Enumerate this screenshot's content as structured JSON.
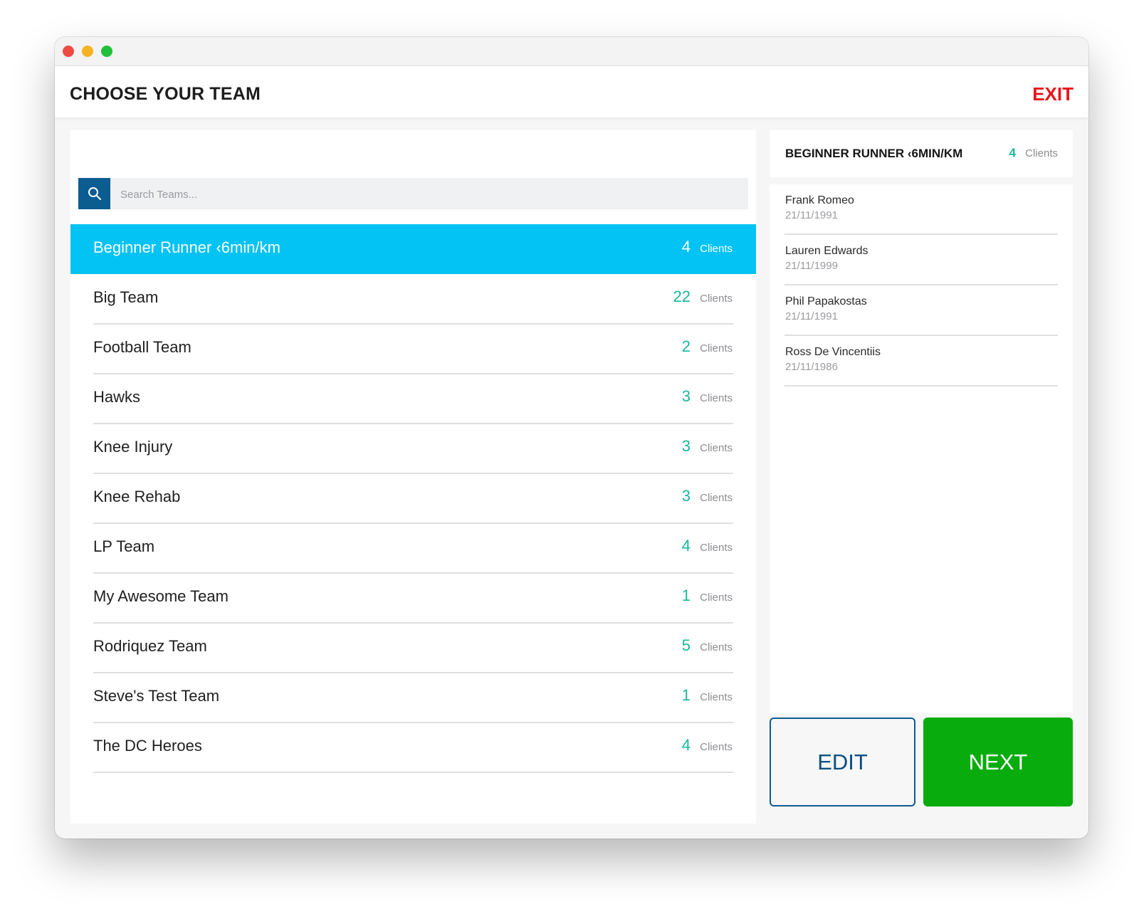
{
  "header": {
    "title": "CHOOSE YOUR TEAM",
    "exit_label": "EXIT"
  },
  "search": {
    "placeholder": "Search Teams..."
  },
  "teams": [
    {
      "name": "Beginner Runner ‹6min/km",
      "count": "4",
      "unit": "Clients",
      "selected": true
    },
    {
      "name": "Big Team",
      "count": "22",
      "unit": "Clients"
    },
    {
      "name": "Football Team",
      "count": "2",
      "unit": "Clients"
    },
    {
      "name": "Hawks",
      "count": "3",
      "unit": "Clients"
    },
    {
      "name": "Knee Injury",
      "count": "3",
      "unit": "Clients"
    },
    {
      "name": "Knee Rehab",
      "count": "3",
      "unit": "Clients"
    },
    {
      "name": "LP Team",
      "count": "4",
      "unit": "Clients"
    },
    {
      "name": "My Awesome Team",
      "count": "1",
      "unit": "Clients"
    },
    {
      "name": "Rodriquez Team",
      "count": "5",
      "unit": "Clients"
    },
    {
      "name": "Steve's Test Team",
      "count": "1",
      "unit": "Clients"
    },
    {
      "name": "The DC Heroes",
      "count": "4",
      "unit": "Clients"
    }
  ],
  "selected_team": {
    "name": "BEGINNER RUNNER ‹6MIN/KM",
    "count": "4",
    "unit": "Clients",
    "members": [
      {
        "name": "Frank Romeo",
        "dob": "21/11/1991"
      },
      {
        "name": "Lauren Edwards",
        "dob": "21/11/1999"
      },
      {
        "name": "Phil Papakostas",
        "dob": "21/11/1991"
      },
      {
        "name": "Ross De Vincentiis",
        "dob": "21/11/1986"
      }
    ]
  },
  "actions": {
    "edit_label": "EDIT",
    "next_label": "NEXT"
  },
  "colors": {
    "accent_selected": "#02c3f4",
    "count_green": "#18b89a",
    "exit_red": "#e8141a",
    "primary_blue": "#0b5c91",
    "next_green": "#08ac0c"
  }
}
